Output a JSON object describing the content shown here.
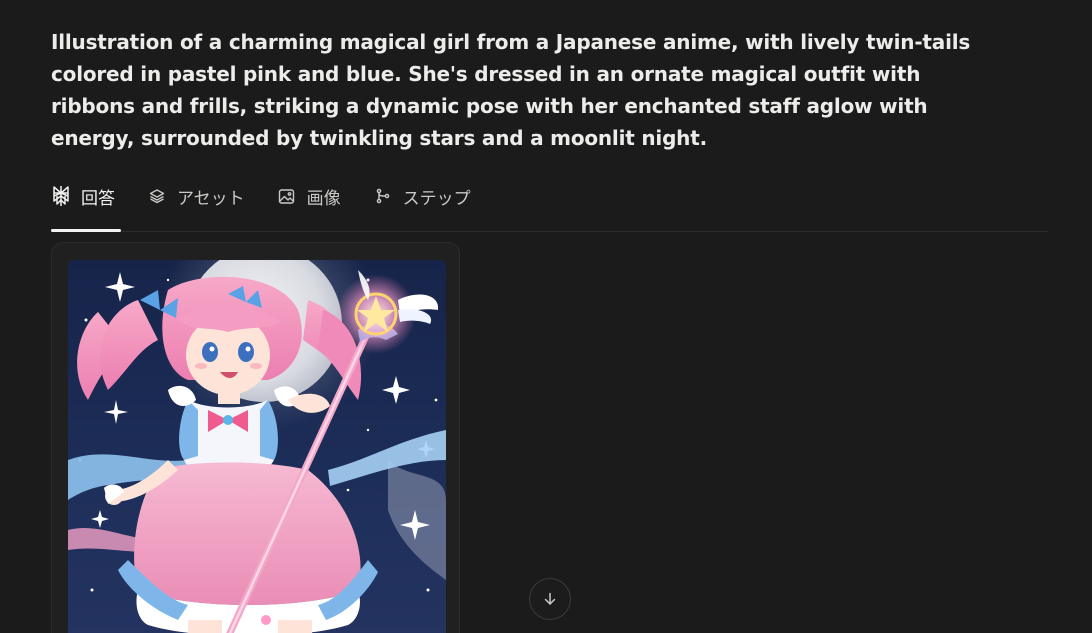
{
  "query": {
    "text": "Illustration of a charming magical girl from a Japanese anime, with lively twin-tails colored in pastel pink and blue. She's dressed in an ornate magical outfit with ribbons and frills, striking a dynamic pose with her enchanted staff aglow with energy, surrounded by twinkling stars and a moonlit night."
  },
  "tabs": [
    {
      "label": "回答",
      "icon": "perplexity-logo-icon",
      "active": true
    },
    {
      "label": "アセット",
      "icon": "layers-icon",
      "active": false
    },
    {
      "label": "画像",
      "icon": "image-icon",
      "active": false
    },
    {
      "label": "ステップ",
      "icon": "branch-icon",
      "active": false
    }
  ],
  "image_result": {
    "subject": "anime magical girl with pink twin-tails holding a glowing star staff under a full moon"
  },
  "scroll_button": {
    "icon": "arrow-down-icon"
  },
  "colors": {
    "background": "#1b1b1b",
    "text": "#ececea",
    "divider": "#2c2c2c",
    "card": "#202020"
  }
}
